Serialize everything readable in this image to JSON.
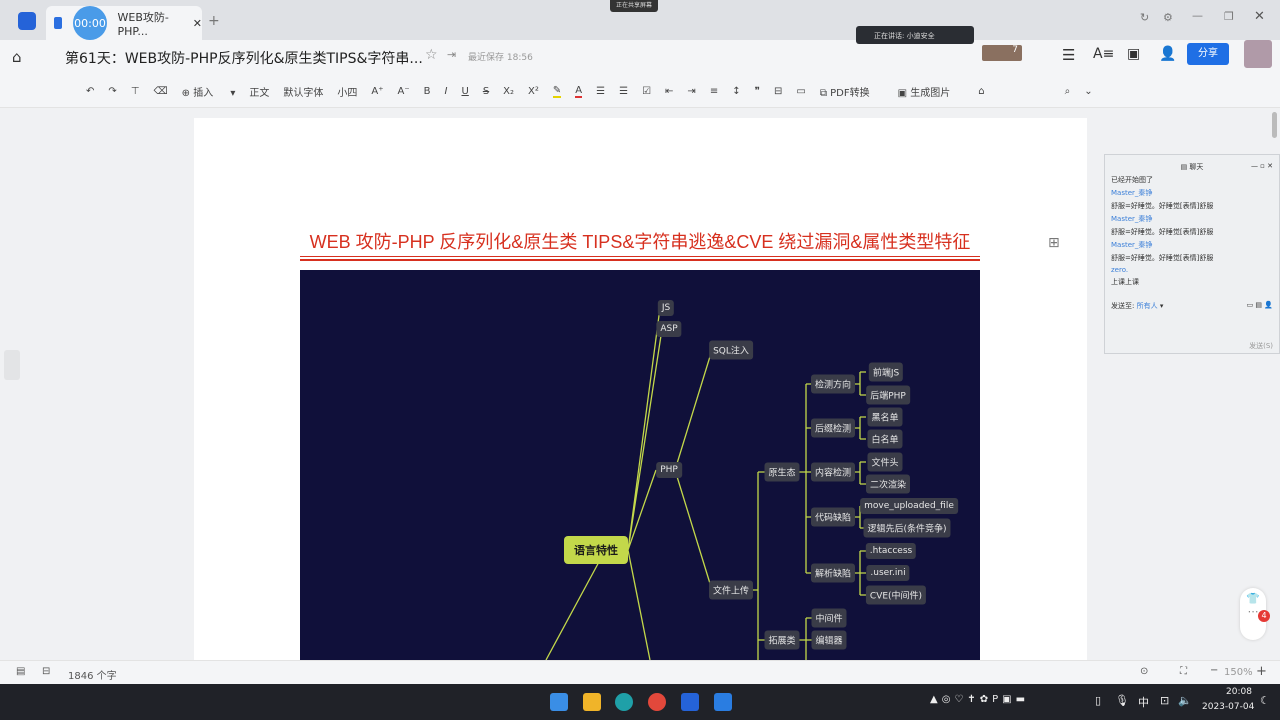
{
  "tab": {
    "timer": "00:00",
    "title": "WEB攻防-PHP...",
    "share_banner": "正在共享屏幕"
  },
  "header": {
    "doc_title": "第61天：WEB攻防-PHP反序列化&原生类TIPS&字符串...",
    "save_status": "最近保存 18:56",
    "collaborator_count": "7",
    "share_label": "分享",
    "speaking": "正在讲话: 小迪安全"
  },
  "toolbar": {
    "insert": "插入",
    "style": "正文",
    "font": "默认字体",
    "size": "小四",
    "pdf": "PDF转换",
    "gen_image": "生成图片"
  },
  "document": {
    "heading": "WEB 攻防-PHP 反序列化&原生类 TIPS&字符串逃逸&CVE 绕过漏洞&属性类型特征"
  },
  "mindmap": {
    "root": "语言特性",
    "nodes": [
      "JS",
      "ASP",
      "SQL注入",
      "PHP",
      "文件上传",
      "原生态",
      "拓展类",
      "检测方向",
      "后缀检测",
      "内容检测",
      "代码缺陷",
      "解析缺陷",
      "前端JS",
      "后端PHP",
      "黑名单",
      "白名单",
      "文件头",
      "二次渲染",
      "move_uploaded_file",
      "逻辑先后(条件竞争)",
      ".htaccess",
      ".user.ini",
      "CVE(中间件)",
      "中间件",
      "编辑器"
    ]
  },
  "chat": {
    "title": "聊天",
    "messages": [
      {
        "text": "已经开始图了"
      },
      {
        "user": "Master_秦铮"
      },
      {
        "text": "舒服=好睡觉。好睡觉[表情]舒服"
      },
      {
        "user": "Master_秦铮"
      },
      {
        "text": "舒服=好睡觉。好睡觉[表情]舒服"
      },
      {
        "user": "Master_秦铮"
      },
      {
        "text": "舒服=好睡觉。好睡觉[表情]舒服"
      },
      {
        "user": "zero."
      },
      {
        "text": "上课上课"
      }
    ],
    "send_to_label": "发送至:",
    "send_to_value": "所有人",
    "send_button": "发送(S)"
  },
  "status": {
    "word_count": "1846 个字",
    "zoom": "150%",
    "badge": "4"
  },
  "taskbar": {
    "time": "20:08",
    "date": "2023-07-04",
    "ime": "中"
  },
  "colors": {
    "accent": "#1f6fe5",
    "heading": "#d7301f",
    "mindmap_bg": "#10103a",
    "root": "#c3d84a"
  }
}
